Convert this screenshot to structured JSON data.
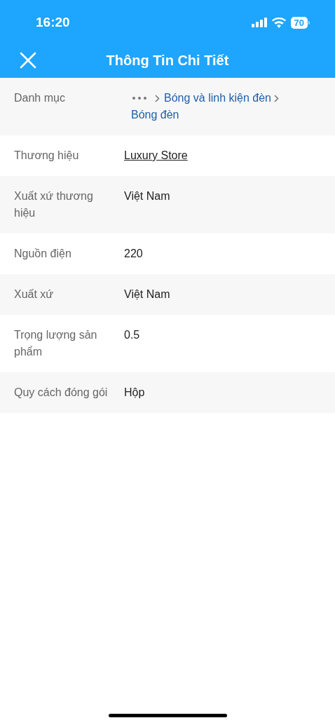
{
  "status_bar": {
    "time": "16:20",
    "battery": "70"
  },
  "header": {
    "title": "Thông Tin Chi Tiết"
  },
  "rows": [
    {
      "label": "Danh mục",
      "kind": "breadcrumb",
      "crumbs": [
        "Bóng và linh kiện đèn",
        "Bóng đèn"
      ]
    },
    {
      "label": "Thương hiệu",
      "kind": "link",
      "value": "Luxury Store"
    },
    {
      "label": "Xuất xứ thương hiệu",
      "kind": "text",
      "value": "Việt Nam"
    },
    {
      "label": "Nguồn điện",
      "kind": "text",
      "value": "220"
    },
    {
      "label": "Xuất xứ",
      "kind": "text",
      "value": "Việt Nam"
    },
    {
      "label": "Trọng lượng sản phẩm",
      "kind": "text",
      "value": "0.5"
    },
    {
      "label": "Quy cách đóng gói",
      "kind": "text",
      "value": "Hộp"
    }
  ]
}
